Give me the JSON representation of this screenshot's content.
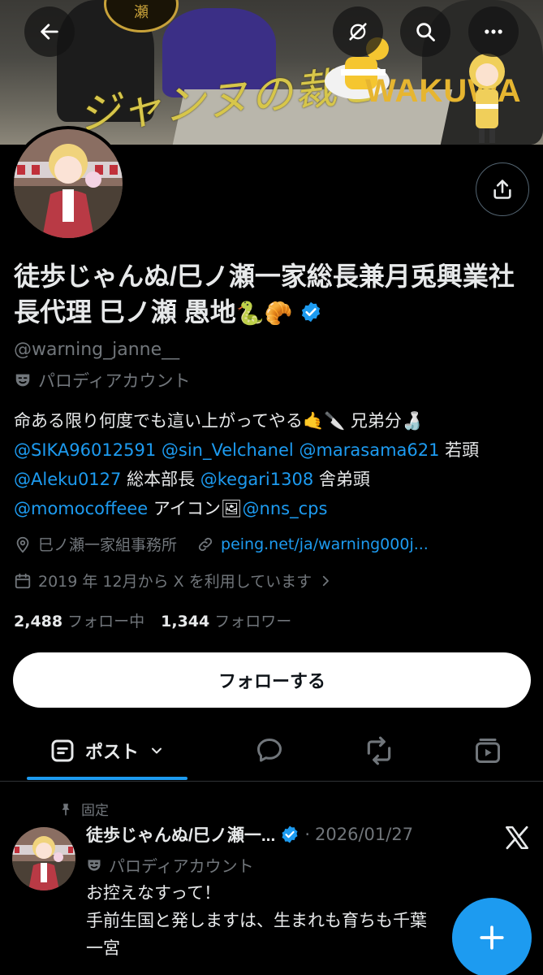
{
  "banner": {
    "emblem_text": "瀬",
    "calligraphy": "ジャンヌの裁き",
    "logo_text": "WAKUWA"
  },
  "profile": {
    "display_name": "徒歩じゃんぬ/巳ノ瀬一家総長兼月兎興業社長代理 巳ノ瀬 愚地",
    "name_emojis": "🐍🥐",
    "handle": "@warning_janne__",
    "parody_label": "パロディアカウント",
    "bio": {
      "line1_text": "命ある限り何度でも這い上がってやる🤙🔪 兄弟分🍶",
      "mention1": "@SIKA96012591",
      "mention2": "@sin_Velchanel",
      "mention3": "@marasama621",
      "text_wakagashira": "若頭",
      "mention4": "@Aleku0127",
      "text_sohonbucho": "総本部長",
      "mention5": "@kegari1308",
      "text_shateigashira": "舎弟頭",
      "mention6": "@momocoffeee",
      "text_icon": "アイコン🖼",
      "mention7": "@nns_cps"
    },
    "location": "巳ノ瀬一家組事務所",
    "website": "peing.net/ja/warning000j...",
    "joined": "2019 年 12月から X を利用しています",
    "following_count": "2,488",
    "following_label": "フォロー中",
    "followers_count": "1,344",
    "followers_label": "フォロワー",
    "follow_button": "フォローする"
  },
  "tabs": {
    "posts_label": "ポスト"
  },
  "pinned_post": {
    "pin_label": "固定",
    "author_name": "徒歩じゃんぬ/巳ノ瀬一...",
    "separator": "·",
    "date": "2026/01/27",
    "parody_label": "パロディアカウント",
    "body": "お控えなすって！\n手前生国と発しますは、生まれも育ちも千葉\n一宮"
  },
  "colors": {
    "accent": "#1d9bf0",
    "background": "#000000",
    "muted": "#71767b"
  },
  "icons": [
    "back-arrow-icon",
    "eye-slash-icon",
    "search-icon",
    "more-icon",
    "share-icon",
    "verified-badge-icon",
    "parody-mask-icon",
    "location-icon",
    "link-icon",
    "calendar-icon",
    "chevron-right-icon",
    "posts-tab-icon",
    "chevron-down-icon",
    "replies-tab-icon",
    "reposts-tab-icon",
    "media-tab-icon",
    "pin-icon",
    "x-logo-icon",
    "compose-plus-icon"
  ]
}
